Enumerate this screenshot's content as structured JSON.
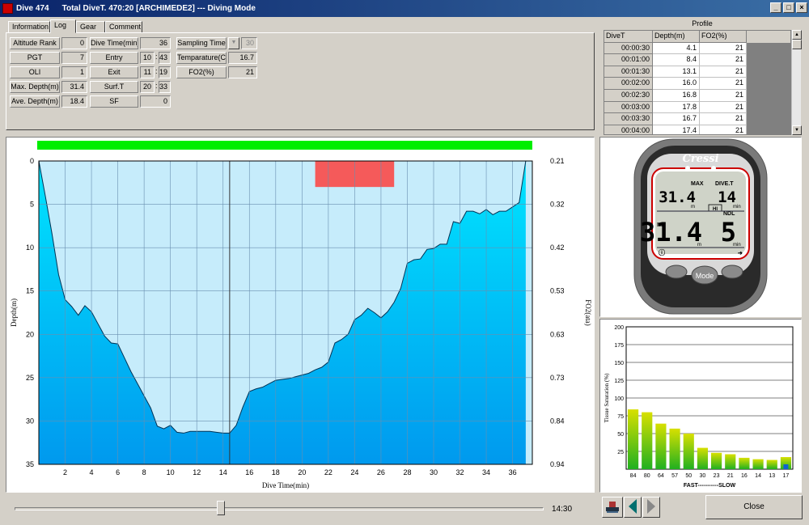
{
  "window": {
    "dive": "Dive 474",
    "title": "Total DiveT. 470:20 [ARCHIMEDE2] --- Diving Mode"
  },
  "tabs": [
    "Information",
    "Log",
    "Gear",
    "Comment"
  ],
  "log": {
    "altitude_rank": {
      "label": "Altitude Rank",
      "value": "0"
    },
    "pgt": {
      "label": "PGT",
      "value": "7"
    },
    "oli": {
      "label": "OLI",
      "value": "1"
    },
    "max_depth": {
      "label": "Max. Depth(m)",
      "value": "31.4"
    },
    "ave_depth": {
      "label": "Ave. Depth(m)",
      "value": "18.4"
    },
    "dive_time": {
      "label": "Dive Time(min)",
      "value": "36"
    },
    "entry": {
      "label": "Entry",
      "h": "10",
      "m": "43"
    },
    "exit": {
      "label": "Exit",
      "h": "11",
      "m": "19"
    },
    "surf_t": {
      "label": "Surf.T",
      "h": "20",
      "m": "33"
    },
    "sf": {
      "label": "SF",
      "value": "0"
    },
    "sampling_time": {
      "label": "Sampling Time",
      "value": "30"
    },
    "temperature": {
      "label": "Temparature(C)",
      "value": "16.7"
    },
    "fo2": {
      "label": "FO2(%)",
      "value": "21"
    }
  },
  "profile": {
    "title": "Profile",
    "headers": [
      "DiveT",
      "Depth(m)",
      "FO2(%)"
    ],
    "rows": [
      [
        "00:00:30",
        "4.1",
        "21"
      ],
      [
        "00:01:00",
        "8.4",
        "21"
      ],
      [
        "00:01:30",
        "13.1",
        "21"
      ],
      [
        "00:02:00",
        "16.0",
        "21"
      ],
      [
        "00:02:30",
        "16.8",
        "21"
      ],
      [
        "00:03:00",
        "17.8",
        "21"
      ],
      [
        "00:03:30",
        "16.7",
        "21"
      ],
      [
        "00:04:00",
        "17.4",
        "21"
      ]
    ]
  },
  "chart_data": [
    {
      "type": "area",
      "xlabel": "Dive Time(min)",
      "ylabel": "Depth(m)",
      "y2label": "FO2(ata)",
      "xlim": [
        0,
        37.5
      ],
      "ylim": [
        0,
        35
      ],
      "xticks": [
        2,
        4,
        6,
        8,
        10,
        12,
        14,
        16,
        18,
        20,
        22,
        24,
        26,
        28,
        30,
        32,
        34,
        36
      ],
      "yticks": [
        0,
        5,
        10,
        15,
        20,
        25,
        30,
        35
      ],
      "y2ticks": [
        "0.21",
        "0.32",
        "0.42",
        "0.53",
        "0.63",
        "0.73",
        "0.84",
        "0.94"
      ],
      "cursor_x": 14.5,
      "highlight": {
        "x": [
          21,
          27
        ],
        "y": [
          0,
          3
        ],
        "color": "#f55a5a"
      },
      "top_bar_color": "#00ee00",
      "x": [
        0,
        0.5,
        1,
        1.5,
        2,
        2.5,
        3,
        3.5,
        4,
        4.5,
        5,
        5.5,
        6,
        6.5,
        7,
        7.5,
        8,
        8.5,
        9,
        9.5,
        10,
        10.5,
        11,
        11.5,
        12,
        12.5,
        13,
        13.5,
        14,
        14.5,
        15,
        15.5,
        16,
        16.5,
        17,
        17.5,
        18,
        18.5,
        19,
        19.5,
        20,
        20.5,
        21,
        21.5,
        22,
        22.5,
        23,
        23.5,
        24,
        24.5,
        25,
        25.5,
        26,
        26.5,
        27,
        27.5,
        28,
        28.5,
        29,
        29.5,
        30,
        30.5,
        31,
        31.5,
        32,
        32.5,
        33,
        33.5,
        34,
        34.5,
        35,
        35.5,
        36,
        36.5,
        37
      ],
      "y": [
        0,
        4.1,
        8.4,
        13.1,
        16,
        16.8,
        17.8,
        16.7,
        17.4,
        18.8,
        20.2,
        21,
        21.1,
        22.7,
        24.3,
        25.7,
        27.1,
        28.5,
        30.6,
        30.9,
        30.5,
        31.3,
        31.4,
        31.2,
        31.2,
        31.2,
        31.2,
        31.3,
        31.4,
        31.4,
        30.5,
        28.4,
        26.6,
        26.3,
        26.1,
        25.7,
        25.3,
        25.2,
        25.1,
        24.9,
        24.7,
        24.5,
        24.1,
        23.8,
        23.2,
        21,
        20.6,
        20,
        18.3,
        17.8,
        17,
        17.5,
        18.1,
        17.4,
        16.3,
        14.7,
        11.8,
        11.4,
        11.3,
        10.2,
        10.1,
        9.6,
        9.6,
        7,
        7.2,
        5.8,
        5.8,
        6.1,
        5.6,
        6.2,
        5.8,
        5.8,
        5.3,
        4.8,
        0
      ],
      "fill_color": "#0099ee",
      "background_color": "#c6ecfb"
    },
    {
      "type": "bar",
      "ylabel": "Tissue Saturation (%)",
      "xlabel": "FAST-----------SLOW",
      "categories": [
        "84",
        "80",
        "64",
        "57",
        "50",
        "30",
        "23",
        "21",
        "16",
        "14",
        "13",
        "17"
      ],
      "values": [
        84,
        80,
        64,
        57,
        50,
        30,
        23,
        21,
        16,
        14,
        13,
        17
      ],
      "ylim": [
        0,
        200
      ],
      "yticks": [
        25,
        50,
        75,
        100,
        125,
        150,
        175,
        200
      ]
    }
  ],
  "computer": {
    "brand": "Cressi",
    "max_label": "MAX",
    "max_value": "31.4",
    "divet_label": "DIVE.T",
    "divet_value": "14",
    "unit_m": "m",
    "unit_min": "min",
    "hi_label": "HI",
    "ndl_label": "NDL",
    "depth_value": "31.4",
    "ndl_value": "5",
    "n2_label": "N2",
    "mode_label": "Mode"
  },
  "playback": {
    "time": "14:30",
    "position": 0.39
  },
  "close_label": "Close"
}
